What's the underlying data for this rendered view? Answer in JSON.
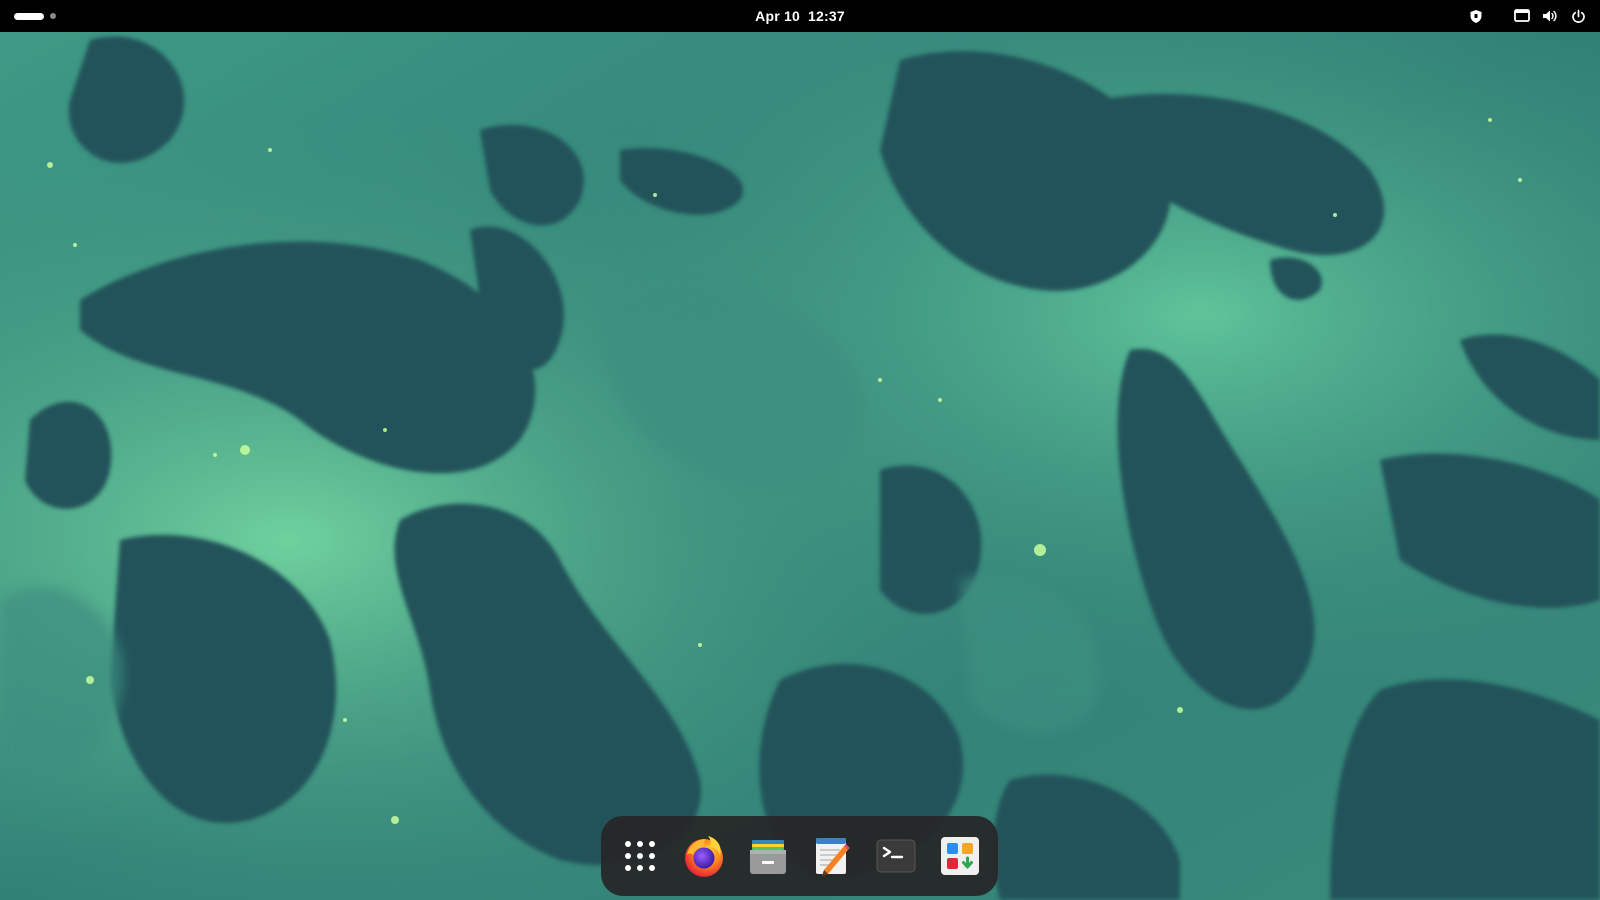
{
  "topbar": {
    "workspaces": [
      {
        "state": "active"
      },
      {
        "state": "inactive"
      }
    ],
    "clock": {
      "date": "Apr 10",
      "time": "12:37"
    },
    "tray": [
      {
        "icon": "shield-icon"
      },
      {
        "icon": "screen-share-icon"
      },
      {
        "icon": "volume-icon"
      },
      {
        "icon": "power-icon"
      }
    ]
  },
  "dock": {
    "items": [
      {
        "app": "show-apps",
        "icon": "app-grid-icon"
      },
      {
        "app": "firefox",
        "icon": "firefox-icon"
      },
      {
        "app": "files",
        "icon": "files-icon"
      },
      {
        "app": "text-editor",
        "icon": "text-editor-icon"
      },
      {
        "app": "terminal",
        "icon": "terminal-icon"
      },
      {
        "app": "software",
        "icon": "software-store-icon"
      }
    ]
  },
  "colors": {
    "topbar_bg": "#000000",
    "wallpaper_dark": "#1f4a4f",
    "wallpaper_mid": "#2f7a72",
    "wallpaper_light": "#5fbf94",
    "dock_bg": "#262626"
  }
}
